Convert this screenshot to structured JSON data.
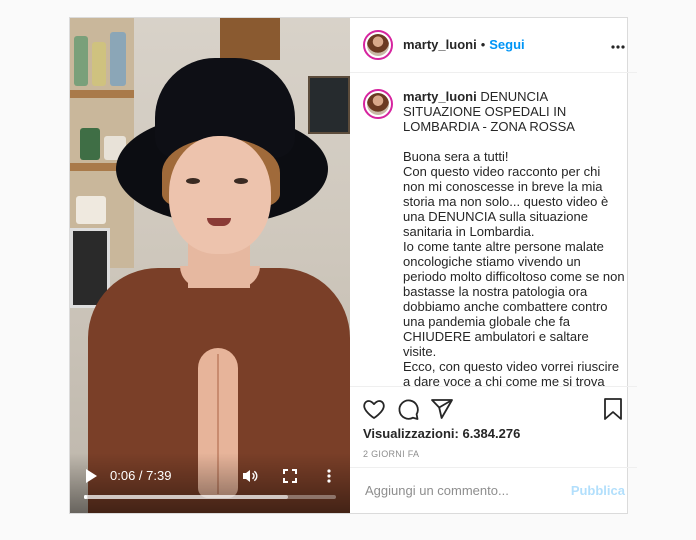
{
  "header": {
    "username": "marty_luoni",
    "separator": "•",
    "follow_label": "Segui",
    "options_icon": "more-horizontal-icon"
  },
  "caption": {
    "username": "marty_luoni",
    "title": "DENUNCIA SITUAZIONE OSPEDALI IN LOMBARDIA - ZONA ROSSA",
    "body": "Buona sera a tutti!\nCon questo video racconto per chi non mi conoscesse in breve la mia storia ma non solo... questo video è una DENUNCIA sulla situazione sanitaria in Lombardia.\nIo come tante altre persone malate oncologiche stiamo vivendo un periodo molto difficoltoso come se non bastasse la nostra patologia ora dobbiamo anche combattere contro una pandemia globale che fa CHIUDERE ambulatori e saltare visite.\nEcco, con questo video vorrei riuscire a dare voce a chi come me si trova ogni giorno a combattere per la"
  },
  "video": {
    "time_display": "0:06 / 7:39",
    "progress_fraction": 0.013,
    "buffered_fraction": 0.81,
    "icons": [
      "play-icon",
      "volume-icon",
      "fullscreen-icon",
      "more-vertical-icon"
    ]
  },
  "stats": {
    "views_label": "Visualizzazioni:",
    "views_value": "6.384.276",
    "date": "2 GIORNI FA"
  },
  "actions": {
    "icons": [
      "heart-icon",
      "comment-icon",
      "share-icon",
      "bookmark-icon"
    ]
  },
  "comment": {
    "placeholder": "Aggiungi un commento...",
    "publish_label": "Pubblica"
  },
  "colors": {
    "accent": "#0095f6",
    "publish_disabled": "#b2dffc",
    "muted": "#8e8e8e"
  }
}
